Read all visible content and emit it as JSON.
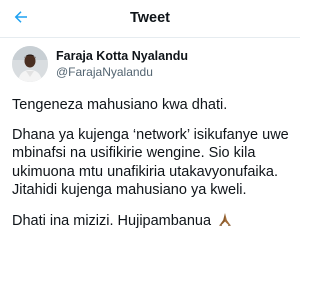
{
  "header": {
    "title": "Tweet",
    "back_icon": "arrow-left-icon",
    "accent_color": "#1da1f2"
  },
  "author": {
    "display_name": "Faraja Kotta Nyalandu",
    "handle": "@FarajaNyalandu"
  },
  "tweet": {
    "paragraphs": [
      "Tengeneza mahusiano kwa dhati.",
      "Dhana ya kujenga ‘network’ isikufanye uwe mbinafsi na usifikirie wengine. Sio kila ukimuona mtu unafikiria utakavyonufaika. Jitahidi kujenga mahusiano ya kweli.",
      "Dhati ina mizizi. Hujipambanua"
    ],
    "emoji_icon": "praying-hands-icon"
  }
}
